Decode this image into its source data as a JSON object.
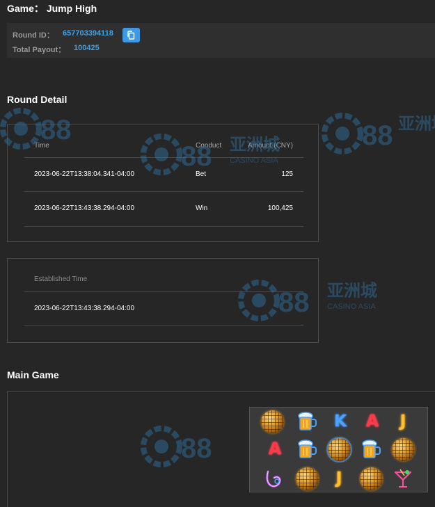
{
  "header": {
    "game_label": "Game：",
    "game_name": "Jump High"
  },
  "round_info": {
    "round_id_label": "Round ID：",
    "round_id": "657703394118",
    "total_payout_label": "Total Payout：",
    "total_payout": "100425",
    "copy_icon": "copy-icon"
  },
  "round_detail": {
    "title": "Round Detail",
    "columns": [
      "Time",
      "Conduct",
      "Amount (CNY)"
    ],
    "rows": [
      {
        "time": "2023-06-22T13:38:04.341-04:00",
        "conduct": "Bet",
        "amount": "125"
      },
      {
        "time": "2023-06-22T13:43:38.294-04:00",
        "conduct": "Win",
        "amount": "100,425"
      }
    ]
  },
  "established": {
    "header": "Established Time",
    "value": "2023-06-22T13:43:38.294-04:00"
  },
  "main_game": {
    "title": "Main Game",
    "reels": [
      [
        "disco-ball",
        "beer-mug",
        "K",
        "A",
        "J"
      ],
      [
        "A",
        "beer-mug",
        "disco-ball",
        "beer-mug",
        "disco-ball"
      ],
      [
        "saxophone",
        "disco-ball",
        "J",
        "disco-ball",
        "cocktail"
      ]
    ]
  },
  "watermark": {
    "logo_text": "88",
    "chinese": "亚洲城",
    "english": "CASINO ASIA"
  },
  "colors": {
    "background": "#262626",
    "accent": "#3fa2e8",
    "copy_button": "#3f9ae6",
    "watermark": "#2f6f9e"
  }
}
